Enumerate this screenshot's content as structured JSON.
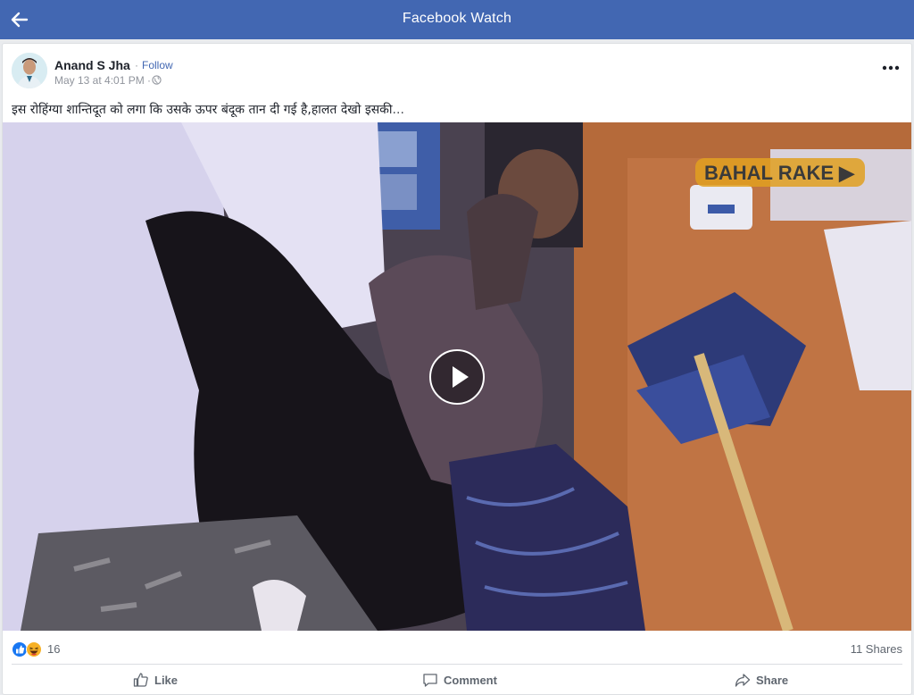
{
  "header": {
    "title": "Facebook Watch",
    "back_icon": "arrow-left-icon"
  },
  "post": {
    "author": "Anand S Jha",
    "follow_separator": "·",
    "follow_label": "Follow",
    "timestamp": "May 13 at 4:01 PM · ",
    "privacy_icon": "globe-icon",
    "more_icon": "more-horizontal-icon",
    "caption": "इस रोहिंग्या शान्तिदूत को लगा कि उसके ऊपर बंदूक तान दी गई है,हालत देखो इसकी",
    "caption_ellipsis": "...",
    "video": {
      "watermark": "BAHAL RAKE ▶",
      "play_icon": "play-icon"
    },
    "reaction_icons": [
      "like-reaction-icon",
      "haha-reaction-icon"
    ],
    "reaction_count": "16",
    "shares_label": "11 Shares",
    "actions": {
      "like": "Like",
      "comment": "Comment",
      "share": "Share"
    }
  },
  "colors": {
    "brand_blue": "#4267b2",
    "background": "#e9ebee",
    "text_muted": "#606770"
  }
}
